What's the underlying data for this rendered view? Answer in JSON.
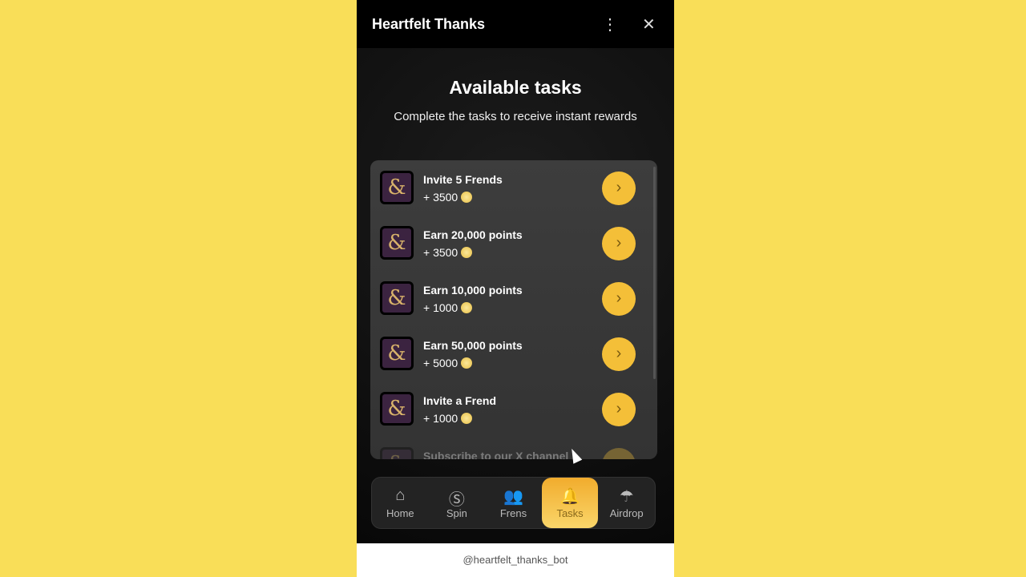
{
  "header": {
    "title": "Heartfelt Thanks",
    "menu_icon": "more-vertical-icon",
    "close_icon": "close-icon"
  },
  "main": {
    "title": "Available tasks",
    "subtitle": "Complete the tasks to receive instant rewards"
  },
  "tasks": [
    {
      "name": "Invite 5 Frends",
      "reward": "+ 3500"
    },
    {
      "name": "Earn 20,000 points",
      "reward": "+ 3500"
    },
    {
      "name": "Earn 10,000 points",
      "reward": "+ 1000"
    },
    {
      "name": "Earn 50,000 points",
      "reward": "+ 5000"
    },
    {
      "name": "Invite a Frend",
      "reward": "+ 1000"
    },
    {
      "name": "Subscribe to our X channel",
      "reward": ""
    }
  ],
  "nav": [
    {
      "label": "Home",
      "icon": "home-icon"
    },
    {
      "label": "Spin",
      "icon": "dollar-circle-icon"
    },
    {
      "label": "Frens",
      "icon": "users-icon"
    },
    {
      "label": "Tasks",
      "icon": "bell-icon",
      "active": true
    },
    {
      "label": "Airdrop",
      "icon": "parachute-icon"
    }
  ],
  "footer": {
    "bot": "@heartfelt_thanks_bot"
  },
  "colors": {
    "background": "#f9de58",
    "accent": "#f4bf38"
  }
}
